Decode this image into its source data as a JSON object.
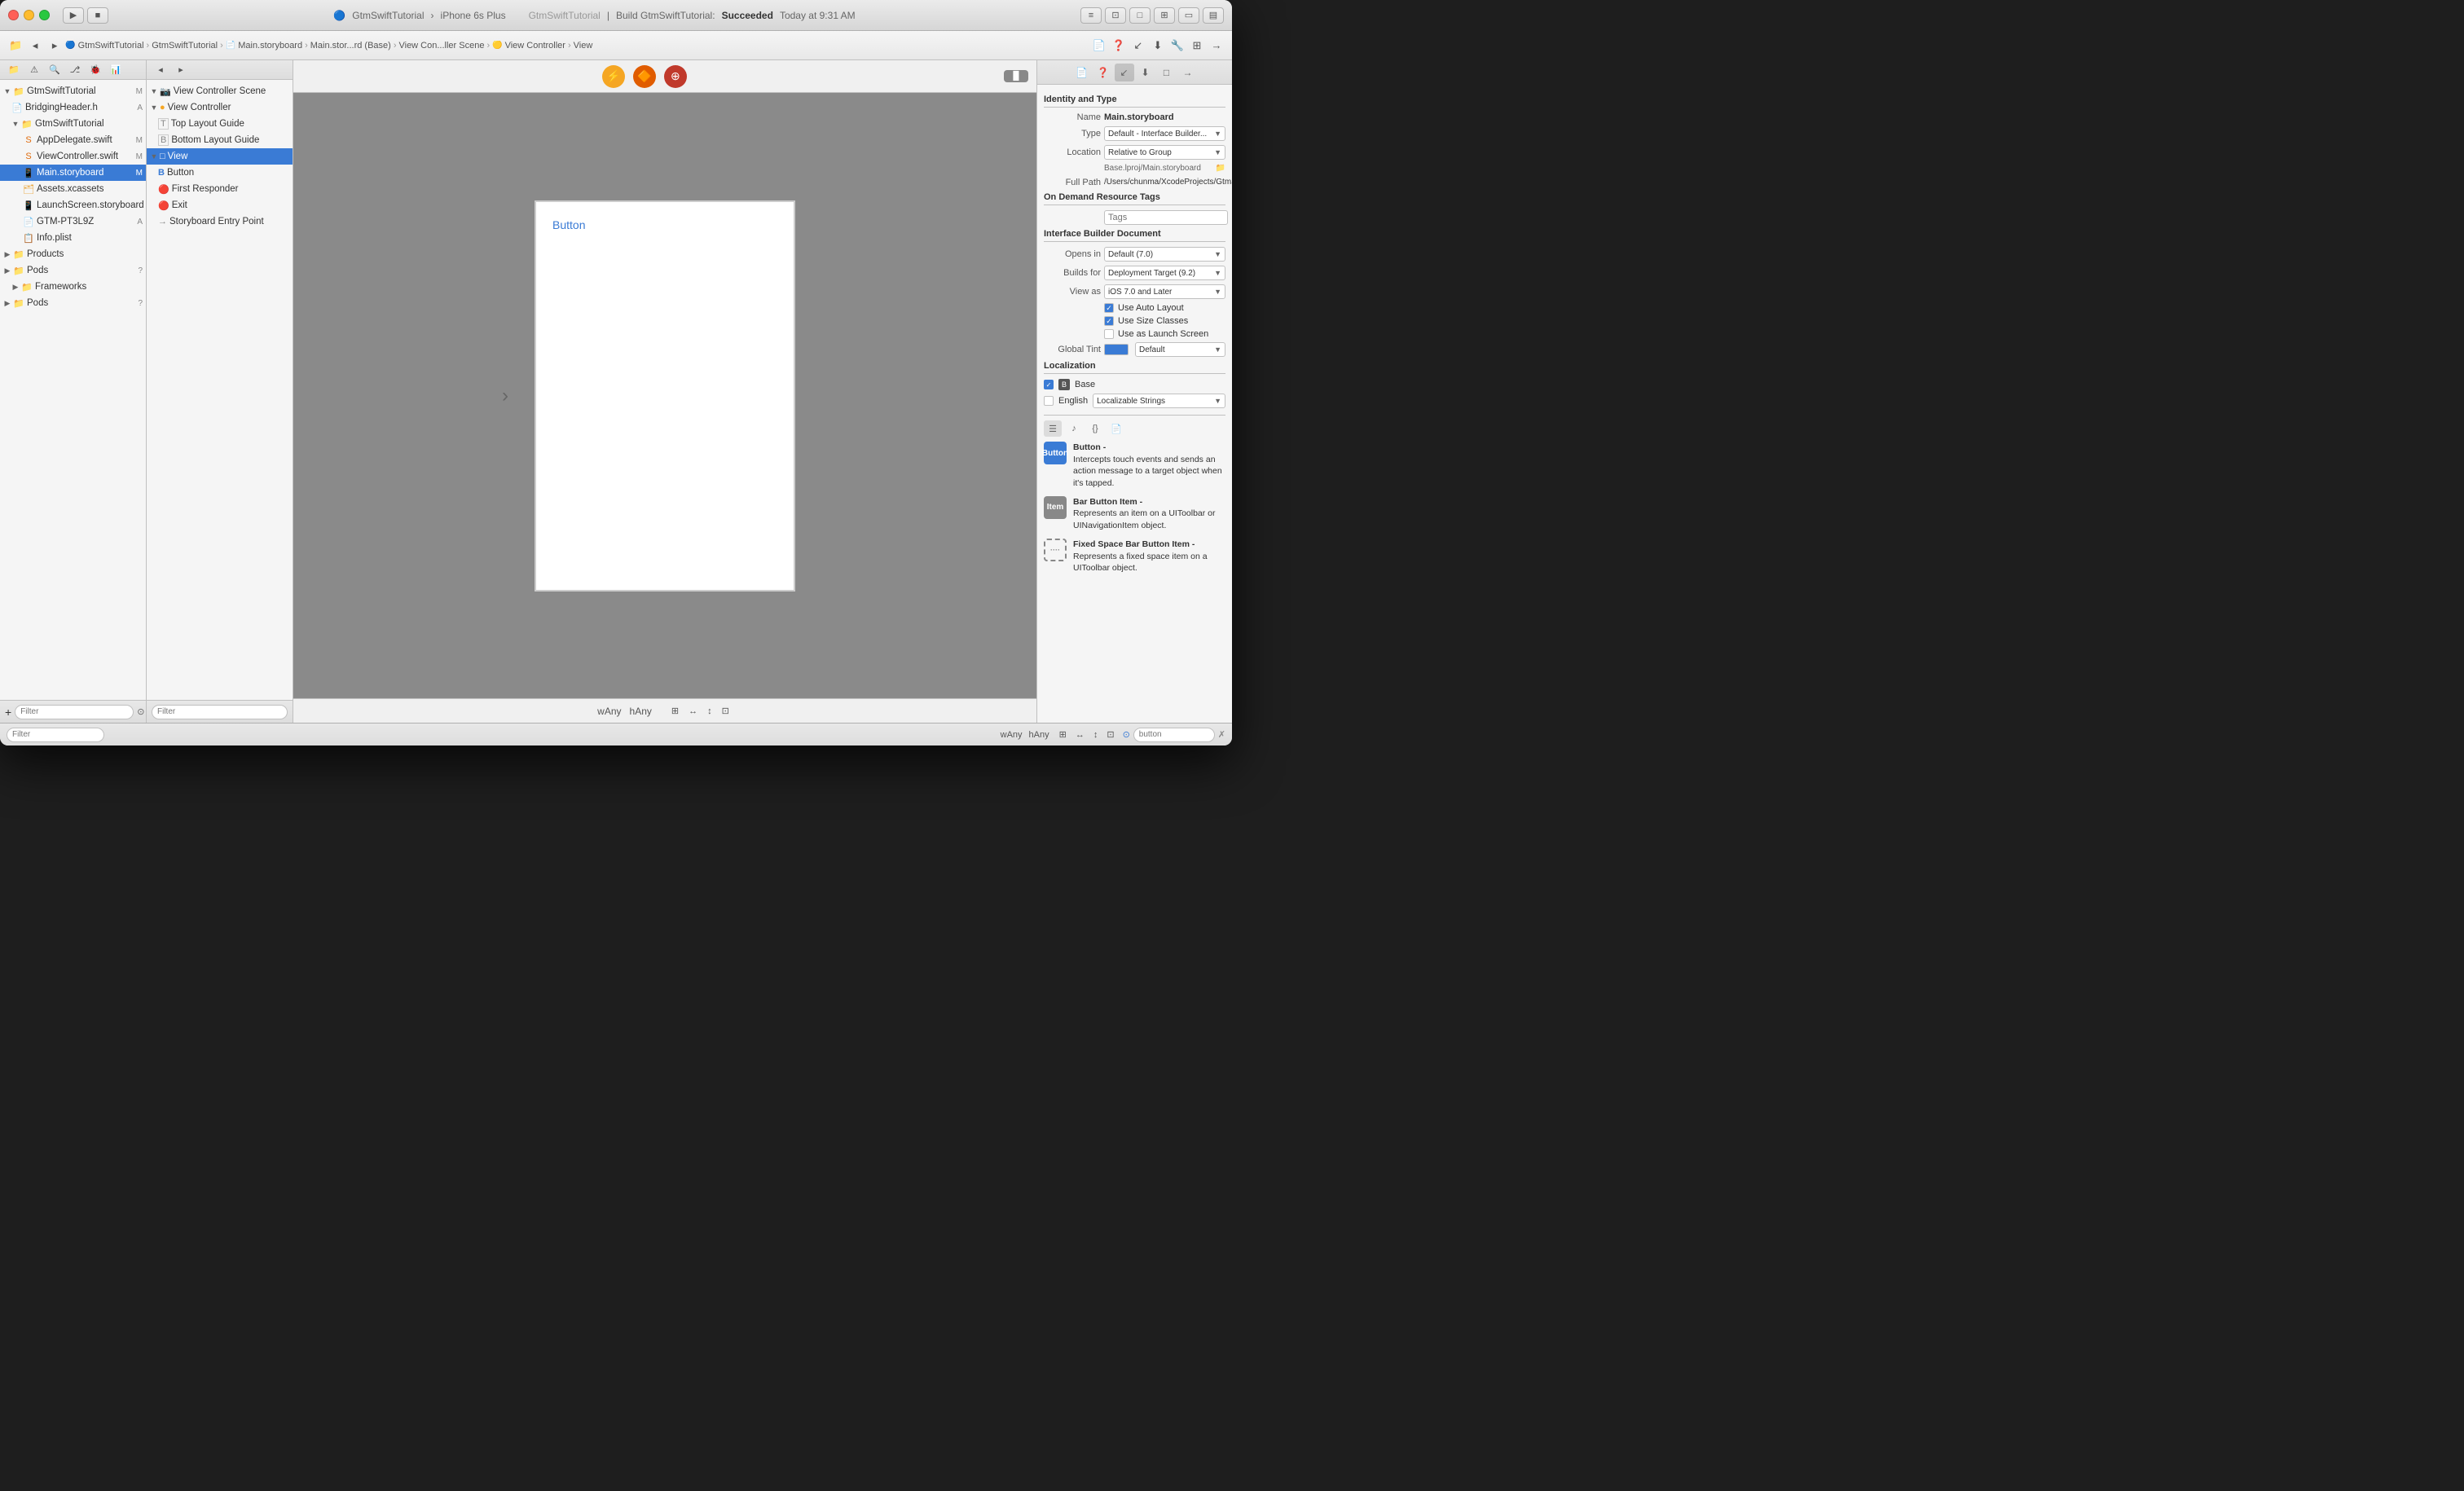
{
  "window": {
    "title": "GtmSwiftTutorial"
  },
  "titlebar": {
    "app_name": "GtmSwiftTutorial",
    "device": "iPhone 6s Plus",
    "project": "GtmSwiftTutorial",
    "build_label": "Build GtmSwiftTutorial:",
    "build_status": "Succeeded",
    "time": "Today at 9:31 AM"
  },
  "breadcrumb": {
    "items": [
      "GtmSwiftTutorial",
      "GtmSwiftTutorial",
      "Main.storyboard",
      "Main.stor...rd (Base)",
      "View Con...ller Scene",
      "View Controller",
      "View"
    ]
  },
  "file_tree": {
    "items": [
      {
        "id": "gtmswifttutorial-root",
        "label": "GtmSwiftTutorial",
        "level": 0,
        "type": "folder",
        "badge": "M",
        "expanded": true
      },
      {
        "id": "bridging-header",
        "label": "BridgingHeader.h",
        "level": 1,
        "type": "file",
        "badge": "A"
      },
      {
        "id": "gtmswifttutorial-group",
        "label": "GtmSwiftTutorial",
        "level": 1,
        "type": "folder",
        "badge": "",
        "expanded": true
      },
      {
        "id": "appdelegate",
        "label": "AppDelegate.swift",
        "level": 2,
        "type": "swift",
        "badge": "M"
      },
      {
        "id": "viewcontroller",
        "label": "ViewController.swift",
        "level": 2,
        "type": "swift",
        "badge": "M"
      },
      {
        "id": "main-storyboard",
        "label": "Main.storyboard",
        "level": 2,
        "type": "storyboard",
        "badge": "M",
        "selected": true
      },
      {
        "id": "assets",
        "label": "Assets.xcassets",
        "level": 2,
        "type": "assets"
      },
      {
        "id": "launchscreen",
        "label": "LaunchScreen.storyboard",
        "level": 2,
        "type": "storyboard"
      },
      {
        "id": "gtm-pt3l9z",
        "label": "GTM-PT3L9Z",
        "level": 2,
        "type": "file",
        "badge": "A"
      },
      {
        "id": "info-plist",
        "label": "Info.plist",
        "level": 2,
        "type": "plist"
      },
      {
        "id": "products",
        "label": "Products",
        "level": 0,
        "type": "folder",
        "badge": ""
      },
      {
        "id": "pods",
        "label": "Pods",
        "level": 0,
        "type": "folder",
        "badge": "?"
      },
      {
        "id": "frameworks",
        "label": "Frameworks",
        "level": 1,
        "type": "folder"
      },
      {
        "id": "pods2",
        "label": "Pods",
        "level": 0,
        "type": "folder",
        "badge": "?"
      }
    ]
  },
  "scene_tree": {
    "items": [
      {
        "id": "vc-scene",
        "label": "View Controller Scene",
        "level": 0,
        "type": "scene",
        "expanded": true
      },
      {
        "id": "view-controller",
        "label": "View Controller",
        "level": 1,
        "type": "vc",
        "expanded": true
      },
      {
        "id": "top-layout",
        "label": "Top Layout Guide",
        "level": 2,
        "type": "layout"
      },
      {
        "id": "bottom-layout",
        "label": "Bottom Layout Guide",
        "level": 2,
        "type": "layout"
      },
      {
        "id": "view",
        "label": "View",
        "level": 2,
        "type": "view",
        "selected": true,
        "expanded": true
      },
      {
        "id": "button",
        "label": "Button",
        "level": 3,
        "type": "button"
      },
      {
        "id": "first-responder",
        "label": "First Responder",
        "level": 1,
        "type": "responder"
      },
      {
        "id": "exit",
        "label": "Exit",
        "level": 1,
        "type": "exit"
      },
      {
        "id": "storyboard-entry",
        "label": "Storyboard Entry Point",
        "level": 0,
        "type": "entry"
      }
    ]
  },
  "canvas": {
    "button_label": "Button",
    "size_w": "wAny",
    "size_h": "hAny"
  },
  "inspector": {
    "title": "Identity and Type",
    "name_label": "Name",
    "name_value": "Main.storyboard",
    "type_label": "Type",
    "type_value": "Default - Interface Builder...",
    "location_label": "Location",
    "location_value": "Relative to Group",
    "relative_path": "Base.lproj/Main.storyboard",
    "full_path_label": "Full Path",
    "full_path_value": "/Users/chunma/XcodeProjects/GtmSwiftTutorial/GtmSwiftTutorial/Base.lproj/Main.storyboard",
    "on_demand_title": "On Demand Resource Tags",
    "tags_placeholder": "Tags",
    "ib_doc_title": "Interface Builder Document",
    "opens_in_label": "Opens in",
    "opens_in_value": "Default (7.0)",
    "builds_for_label": "Builds for",
    "builds_for_value": "Deployment Target (9.2)",
    "view_as_label": "View as",
    "view_as_value": "iOS 7.0 and Later",
    "auto_layout_label": "Use Auto Layout",
    "auto_layout_checked": true,
    "size_classes_label": "Use Size Classes",
    "size_classes_checked": true,
    "launch_screen_label": "Use as Launch Screen",
    "launch_screen_checked": false,
    "global_tint_label": "Global Tint",
    "global_tint_value": "Default",
    "localization_title": "Localization",
    "base_label": "Base",
    "english_label": "English",
    "english_select": "Localizable Strings"
  },
  "object_library": {
    "button_title": "Button",
    "button_desc": "Intercepts touch events and sends an action message to a target object when it's tapped.",
    "bar_button_title": "Bar Button Item",
    "bar_button_desc": "Represents an item on a UIToolbar or UINavigationItem object.",
    "fixed_space_title": "Fixed Space Bar Button Item",
    "fixed_space_desc": "Represents a fixed space item on a UIToolbar object."
  },
  "bottom": {
    "filter_placeholder": "Filter",
    "filter2_placeholder": "Filter",
    "button_label": "button",
    "size_w": "wAny",
    "size_h": "hAny"
  }
}
